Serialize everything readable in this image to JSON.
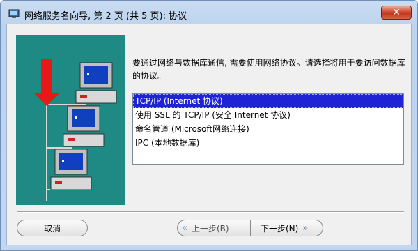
{
  "window": {
    "title": "网络服务名向导, 第 2 页 (共 5 页): 协议",
    "close_glyph": "✕"
  },
  "prompt": "要通过网络与数据库通信, 需要使用网络协议。请选择将用于要访问数据库的协议。",
  "protocols": {
    "selected_index": 0,
    "items": [
      "TCP/IP (Internet 协议)",
      "使用 SSL 的 TCP/IP (安全 Internet 协议)",
      "命名管道 (Microsoft网络连接)",
      "IPC (本地数据库)"
    ]
  },
  "buttons": {
    "cancel": "取消",
    "back": "上一步(B)",
    "next": "下一步(N)"
  },
  "colors": {
    "graphic_bg": "#1f8a84",
    "selection": "#1f23d6",
    "arrow": "#e81818"
  }
}
